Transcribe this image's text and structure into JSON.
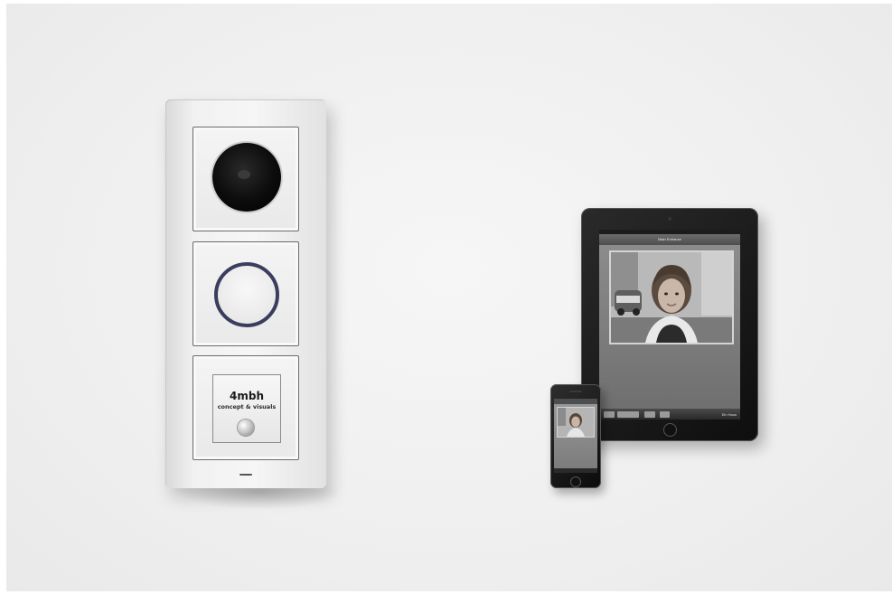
{
  "door_station": {
    "name_plate": {
      "title": "4mbh",
      "subtitle": "concept & visuals"
    }
  },
  "tablet": {
    "title": "Main Entrance",
    "toolbar": {
      "door_label": "Ein Haus"
    }
  }
}
